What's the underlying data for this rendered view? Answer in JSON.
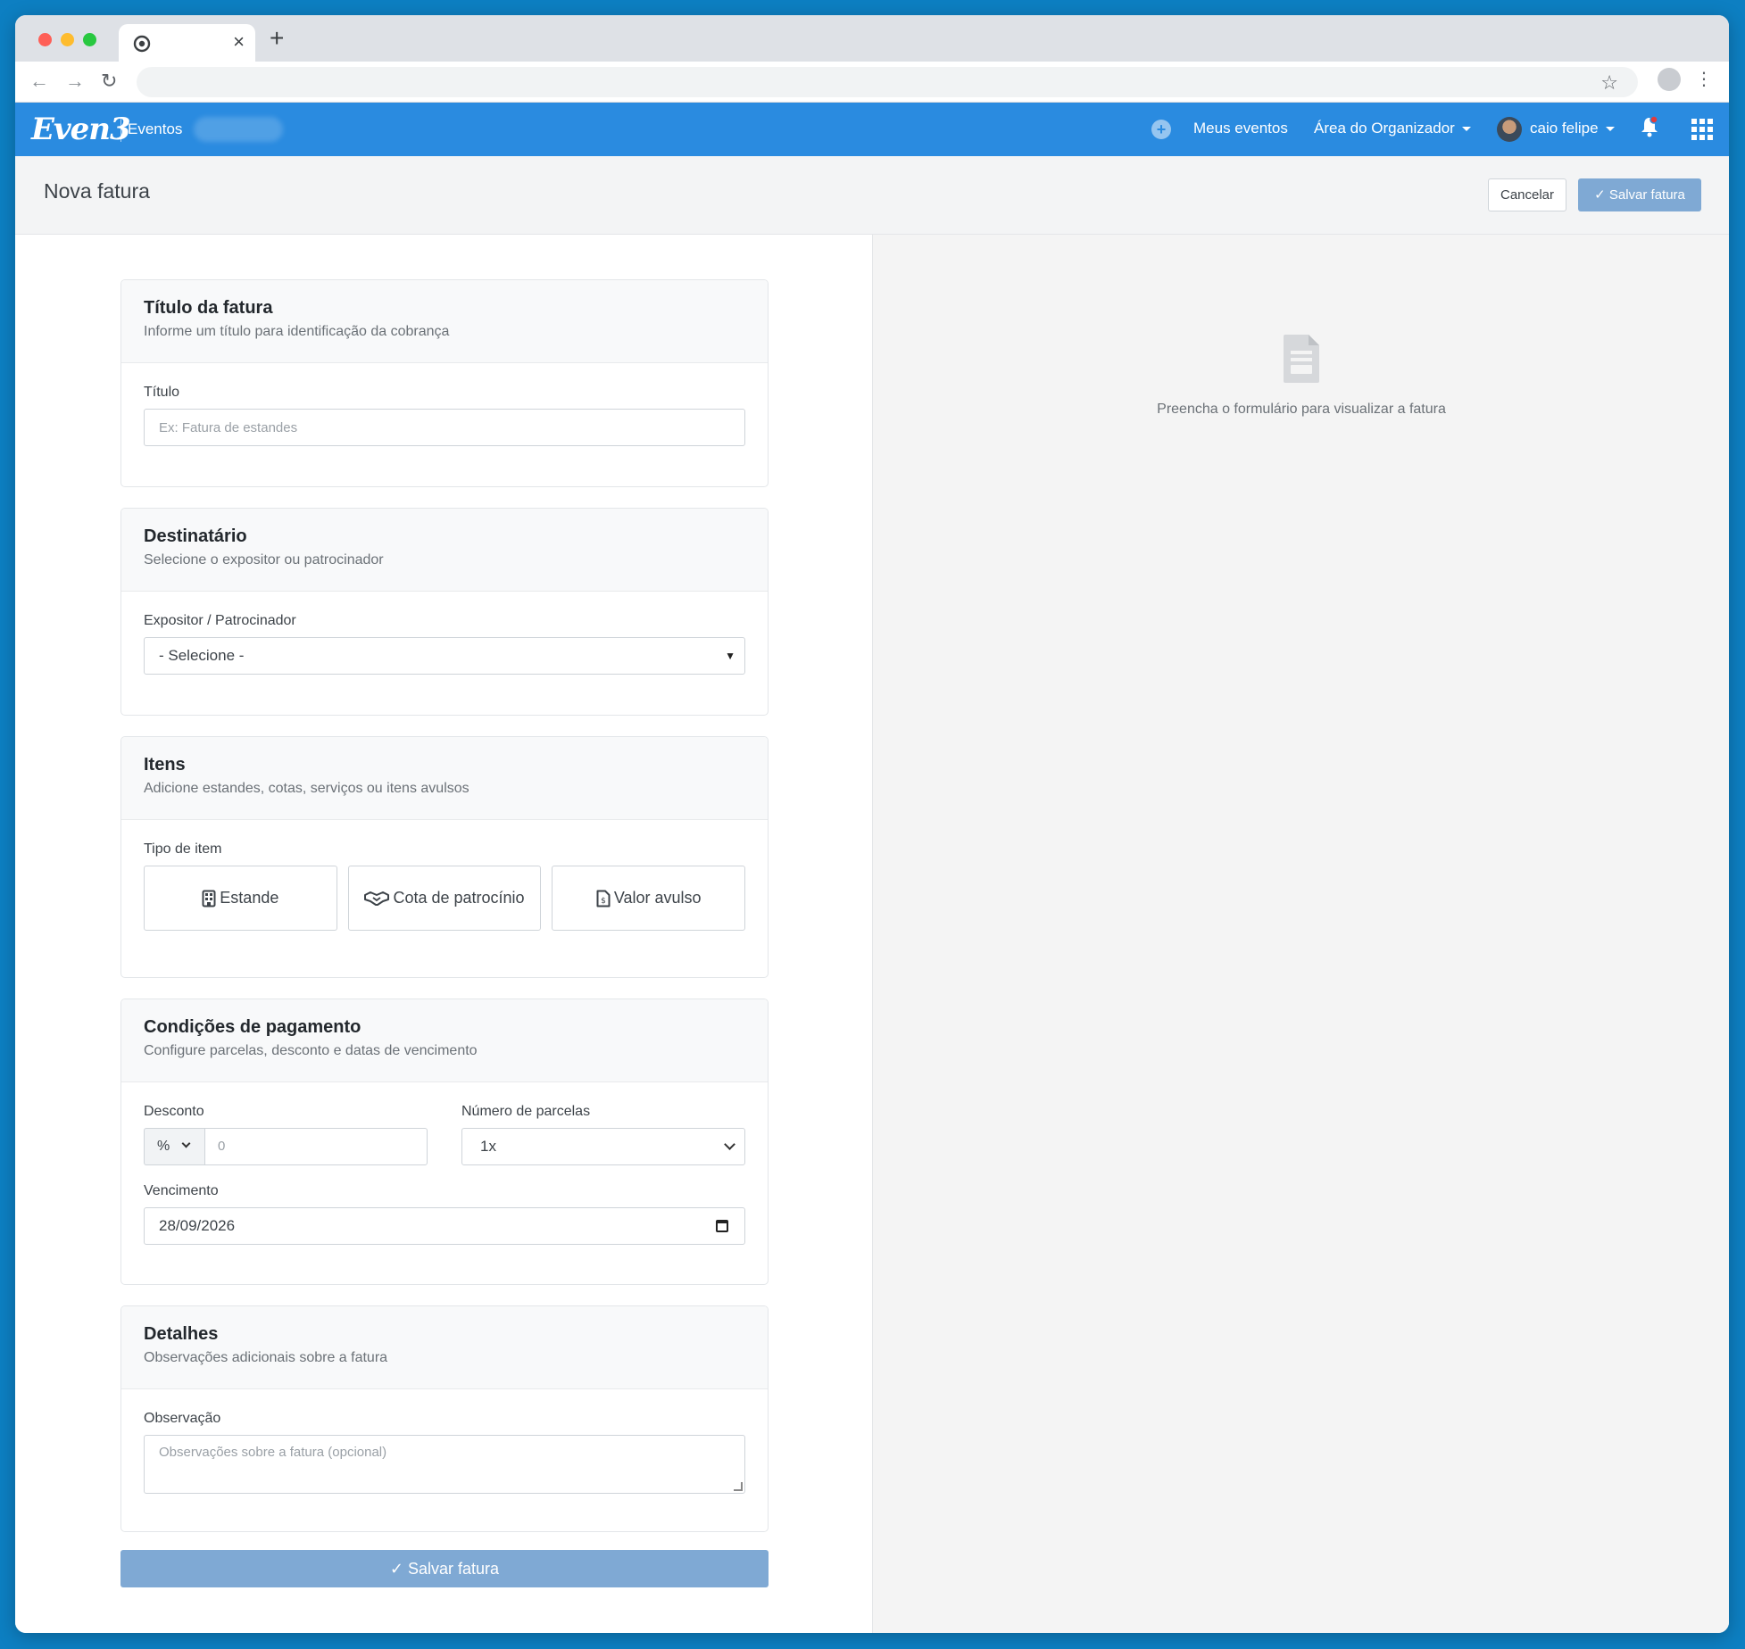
{
  "browser": {
    "new_tab_symbol": "+",
    "close_symbol": "×"
  },
  "appbar": {
    "logo": "Even3",
    "logo_sub": "Eventos",
    "nav": {
      "my_events": "Meus eventos",
      "organizer_area": "Área do Organizador",
      "user_name": "caio felipe"
    }
  },
  "page": {
    "title": "Nova fatura",
    "cancel_label": "Cancelar",
    "save_label": "Salvar fatura"
  },
  "sections": {
    "title": {
      "heading": "Título da fatura",
      "sub": "Informe um título para identificação da cobrança",
      "field_label": "Título",
      "placeholder": "Ex: Fatura de estandes"
    },
    "recipient": {
      "heading": "Destinatário",
      "sub": "Selecione o expositor ou patrocinador",
      "field_label": "Expositor / Patrocinador",
      "selected": "- Selecione -"
    },
    "items": {
      "heading": "Itens",
      "sub": "Adicione estandes, cotas, serviços ou itens avulsos",
      "field_label": "Tipo de item",
      "types": [
        {
          "label": "Estande",
          "icon": "building-icon"
        },
        {
          "label": "Cota de patrocínio",
          "icon": "handshake-icon"
        },
        {
          "label": "Valor avulso",
          "icon": "invoice-dollar-icon"
        }
      ]
    },
    "payment": {
      "heading": "Condições de pagamento",
      "sub": "Configure parcelas, desconto e datas de vencimento",
      "discount_label": "Desconto",
      "discount_unit": "%",
      "discount_placeholder": "0",
      "installments_label": "Número de parcelas",
      "installments_value": "1x",
      "due_label": "Vencimento",
      "due_value": "28/09/2026"
    },
    "details": {
      "heading": "Detalhes",
      "sub": "Observações adicionais sobre a fatura",
      "field_label": "Observação",
      "placeholder": "Observações sobre a fatura (opcional)"
    }
  },
  "preview": {
    "empty_text": "Preencha o formulário para visualizar a fatura"
  },
  "colors": {
    "appbar": "#2a8be0",
    "save_button": "#7fa9d4",
    "outer_bg": "#0d7fc2"
  }
}
